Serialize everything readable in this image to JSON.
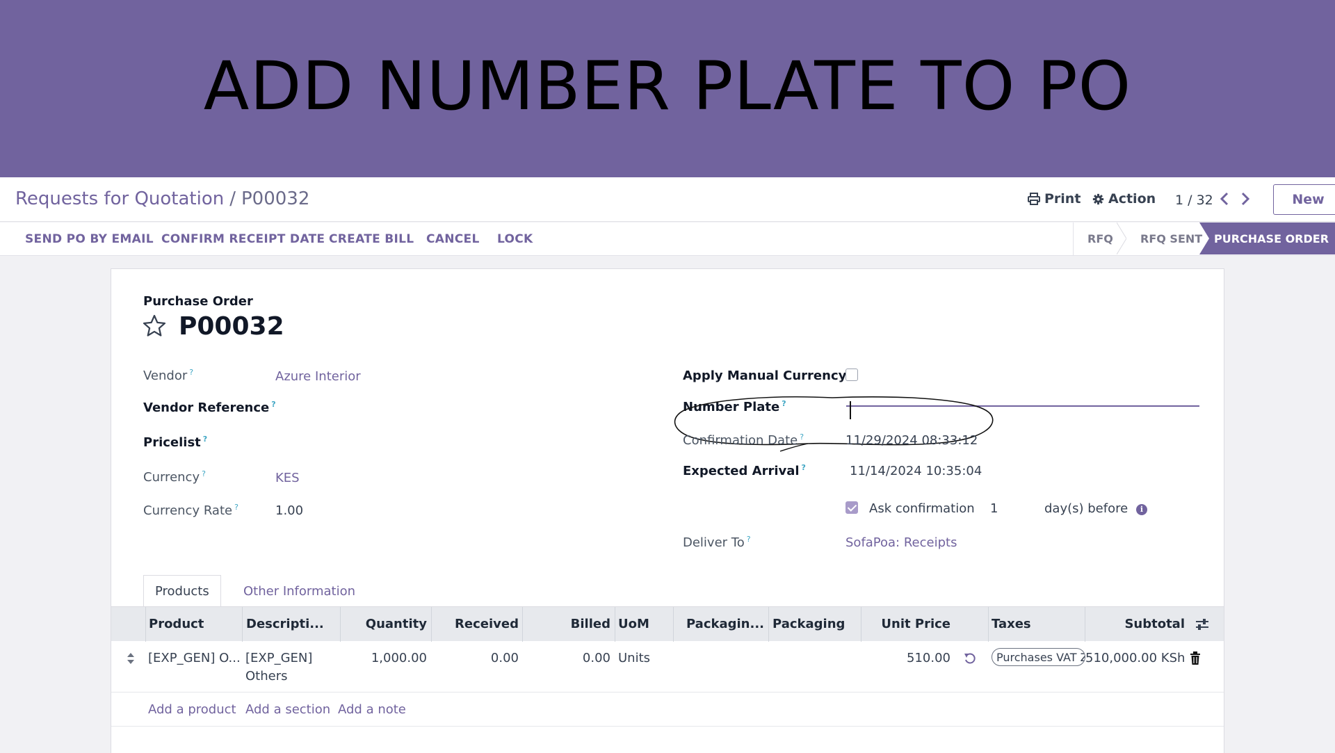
{
  "banner": {
    "title": "ADD NUMBER PLATE TO PO"
  },
  "breadcrumb": {
    "parent": "Requests for Quotation",
    "separator": "/",
    "current": "P00032"
  },
  "control_panel": {
    "print_label": "Print",
    "action_label": "Action",
    "pager": "1 / 32",
    "new_label": "New"
  },
  "actions": [
    "SEND PO BY EMAIL",
    "CONFIRM RECEIPT DATE",
    "CREATE BILL",
    "CANCEL",
    "LOCK"
  ],
  "statusbar": {
    "steps": [
      "RFQ",
      "RFQ SENT",
      "PURCHASE ORDER"
    ],
    "active": "PURCHASE ORDER"
  },
  "form": {
    "doc_label": "Purchase Order",
    "doc_name": "P00032",
    "left": {
      "vendor_label": "Vendor",
      "vendor_value": "Azure Interior",
      "vendor_ref_label": "Vendor Reference",
      "pricelist_label": "Pricelist",
      "currency_label": "Currency",
      "currency_value": "KES",
      "currency_rate_label": "Currency Rate",
      "currency_rate_value": "1.00"
    },
    "right": {
      "manual_currency_label": "Apply Manual Currency",
      "number_plate_label": "Number Plate",
      "number_plate_value": "",
      "confirmation_date_label": "Confirmation Date",
      "confirmation_date_value": "11/29/2024 08:33:12",
      "expected_arrival_label": "Expected Arrival",
      "expected_arrival_value": "11/14/2024 10:35:04",
      "ask_confirmation_label": "Ask confirmation",
      "ask_confirmation_days": "1",
      "days_before_label": "day(s) before",
      "deliver_to_label": "Deliver To",
      "deliver_to_value": "SofaPoa: Receipts"
    },
    "help_marker": "?"
  },
  "tabs": [
    "Products",
    "Other Information"
  ],
  "table": {
    "headers": [
      "Product",
      "Descripti...",
      "Quantity",
      "Received",
      "Billed",
      "UoM",
      "Packagin...",
      "Packaging",
      "Unit Price",
      "Taxes",
      "Subtotal"
    ],
    "rows": [
      {
        "product": "[EXP_GEN] O...",
        "description_line1": "[EXP_GEN]",
        "description_line2": "Others",
        "quantity": "1,000.00",
        "received": "0.00",
        "billed": "0.00",
        "uom": "Units",
        "unit_price": "510.00",
        "taxes": "Purchases VAT Z",
        "subtotal": "510,000.00 KSh"
      }
    ],
    "add_links": [
      "Add a product",
      "Add a section",
      "Add a note"
    ]
  },
  "colors": {
    "brand": "#71639e",
    "banner": "#71639e",
    "help": "#3fa6c4"
  }
}
